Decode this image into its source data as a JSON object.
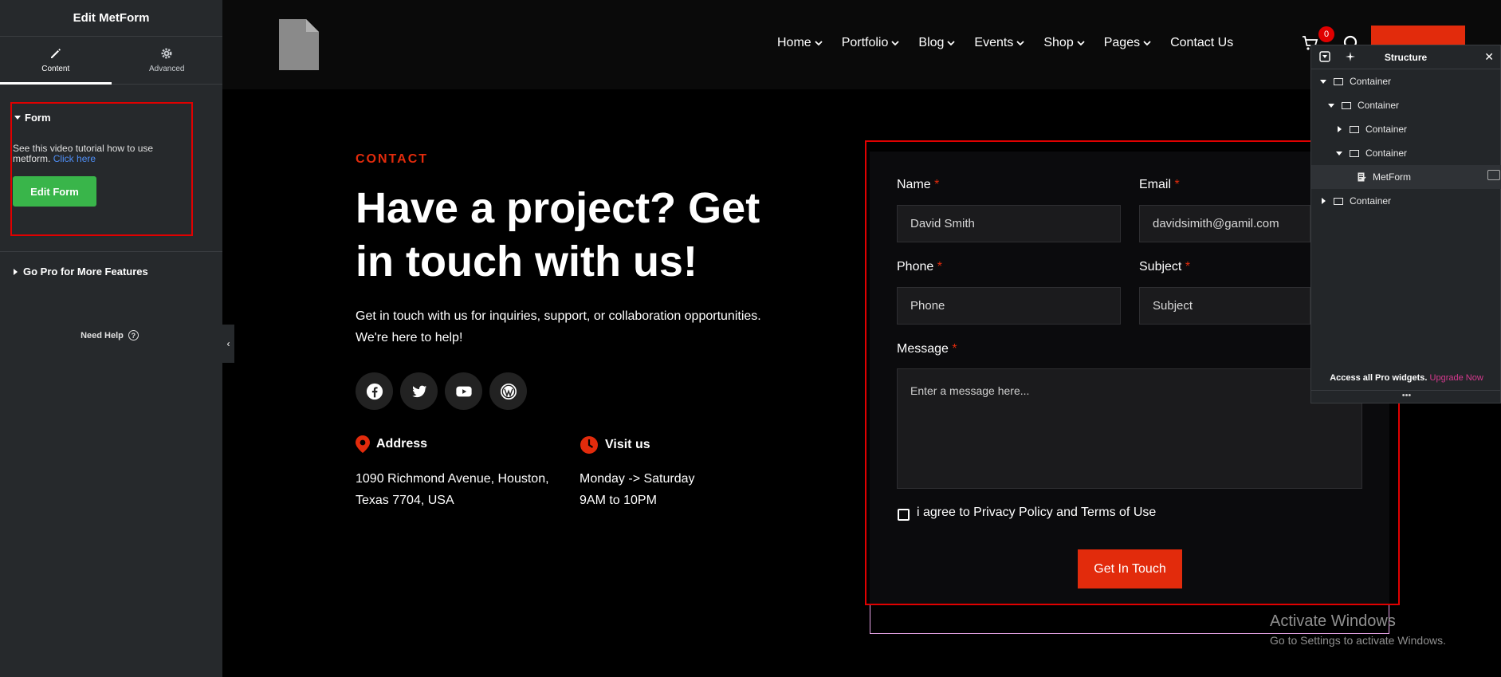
{
  "panel": {
    "title": "Edit MetForm",
    "tabs": [
      {
        "label": "Content",
        "icon": "pencil-icon",
        "active": true
      },
      {
        "label": "Advanced",
        "icon": "gear-icon",
        "active": false
      }
    ],
    "form_section": {
      "title": "Form",
      "tutorial_text": "See this video tutorial how to use metform.",
      "click_here": "Click here",
      "edit_button": "Edit Form"
    },
    "go_pro": "Go Pro for More Features",
    "need_help": "Need Help",
    "need_help_icon": "?",
    "collapse_icon": "‹"
  },
  "header": {
    "nav": [
      {
        "label": "Home",
        "dropdown": true
      },
      {
        "label": "Portfolio",
        "dropdown": true
      },
      {
        "label": "Blog",
        "dropdown": true
      },
      {
        "label": "Events",
        "dropdown": true
      },
      {
        "label": "Shop",
        "dropdown": true
      },
      {
        "label": "Pages",
        "dropdown": true
      },
      {
        "label": "Contact Us",
        "dropdown": false
      }
    ],
    "cart_count": "0",
    "cta_button": ""
  },
  "contact": {
    "eyebrow": "CONTACT",
    "headline": "Have a project? Get in touch with us!",
    "intro": "Get in touch with us for inquiries, support, or collaboration opportunities. We're here to help!",
    "socials": [
      "facebook-icon",
      "twitter-icon",
      "youtube-icon",
      "wordpress-icon"
    ],
    "address": {
      "label": "Address",
      "line1": "1090 Richmond Avenue, Houston,",
      "line2": "Texas 7704, USA"
    },
    "visit": {
      "label": "Visit us",
      "line1": "Monday -> Saturday",
      "line2": "9AM to 10PM"
    }
  },
  "form": {
    "name": {
      "label": "Name",
      "value": "David Smith"
    },
    "email": {
      "label": "Email",
      "value": "davidsimith@gamil.com"
    },
    "phone": {
      "label": "Phone",
      "placeholder": "Phone"
    },
    "subject": {
      "label": "Subject",
      "placeholder": "Subject"
    },
    "message": {
      "label": "Message",
      "placeholder": "Enter a message here..."
    },
    "required_mark": "*",
    "agree_label": "i agree to Privacy Policy and Terms of Use",
    "submit": "Get In Touch"
  },
  "structure": {
    "title": "Structure",
    "close": "✕",
    "rows": [
      {
        "label": "Container",
        "depth": 0,
        "expanded": true
      },
      {
        "label": "Container",
        "depth": 1,
        "expanded": true
      },
      {
        "label": "Container",
        "depth": 2,
        "expanded": false
      },
      {
        "label": "Container",
        "depth": 2,
        "expanded": true
      },
      {
        "label": "MetForm",
        "depth": 3,
        "widget": true,
        "selected": true
      },
      {
        "label": "Container",
        "depth": 0,
        "expanded": false
      }
    ],
    "footer_text": "Access all Pro widgets.",
    "footer_link": "Upgrade Now",
    "dots": "•••"
  },
  "watermark": {
    "title": "Activate Windows",
    "subtitle": "Go to Settings to activate Windows."
  },
  "colors": {
    "accent": "#e22b0c",
    "edit_button": "#39b54a",
    "link": "#4f8ff7",
    "upgrade_link": "#d5398e",
    "highlight_outline": "#e00000"
  }
}
